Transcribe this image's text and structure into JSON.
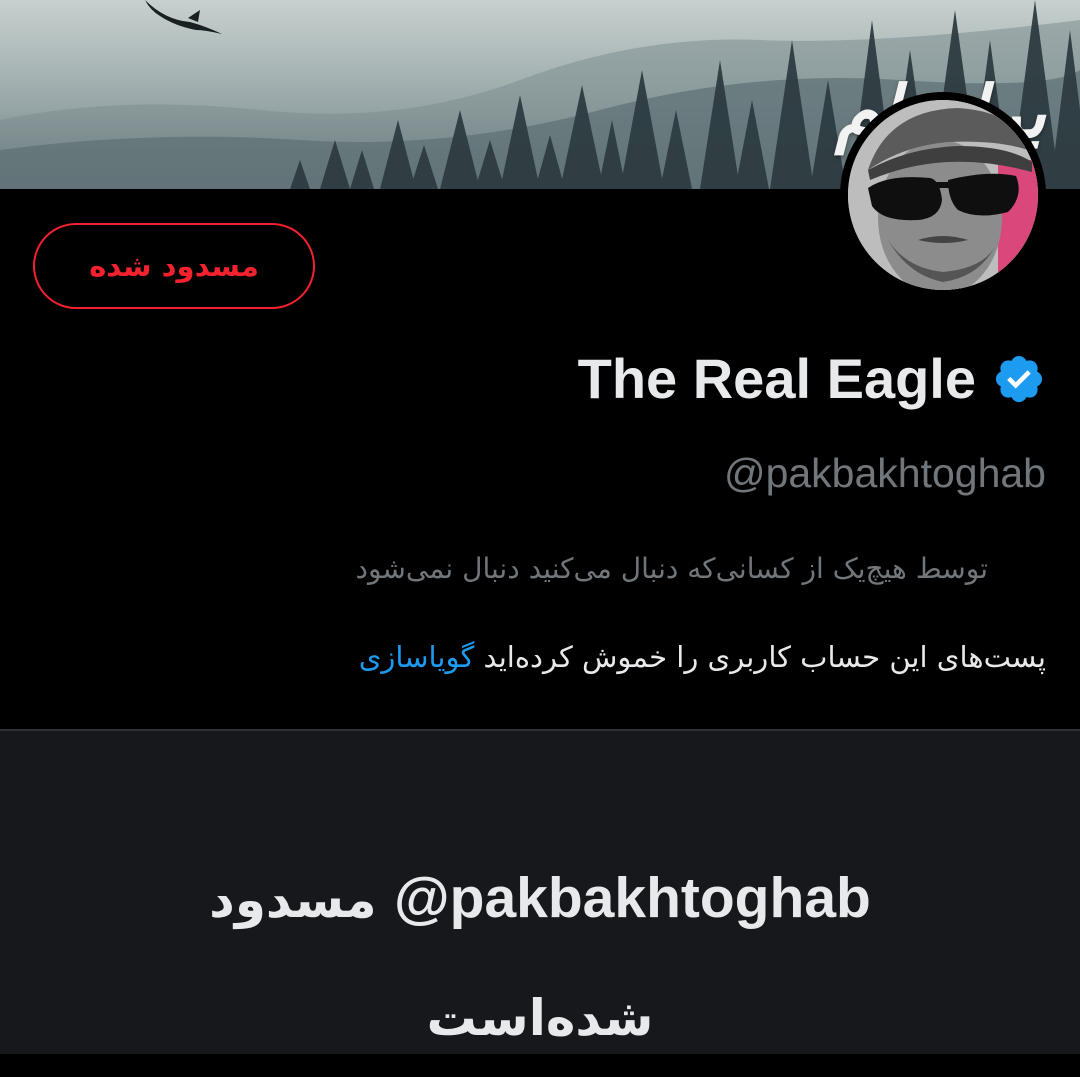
{
  "banner": {
    "overlay_text": "برازدام",
    "image": "misty-forest-with-eagle"
  },
  "profile": {
    "avatar": "man-with-sunglasses-avatar",
    "display_name": "The Real Eagle",
    "verified": true,
    "handle": "@pakbakhtoghab",
    "followed_by": "توسط هیچ‌یک از کسانی‌که دنبال می‌کنید دنبال نمی‌شود",
    "muted_text": "پست‌های این حساب کاربری را خموش کرده‌اید",
    "unmute_label": "گویاسازی"
  },
  "actions": {
    "blocked_label": "مسدود شده"
  },
  "blocked_notice": {
    "handle": "@pakbakhtoghab",
    "prefix": "مسدود",
    "suffix": "شده‌است"
  },
  "colors": {
    "background": "#000000",
    "panel": "#16181c",
    "text_primary": "#e7e9ea",
    "text_secondary": "#71767b",
    "danger": "#f4212e",
    "link": "#1d9bf0",
    "verified": "#1d9bf0"
  }
}
